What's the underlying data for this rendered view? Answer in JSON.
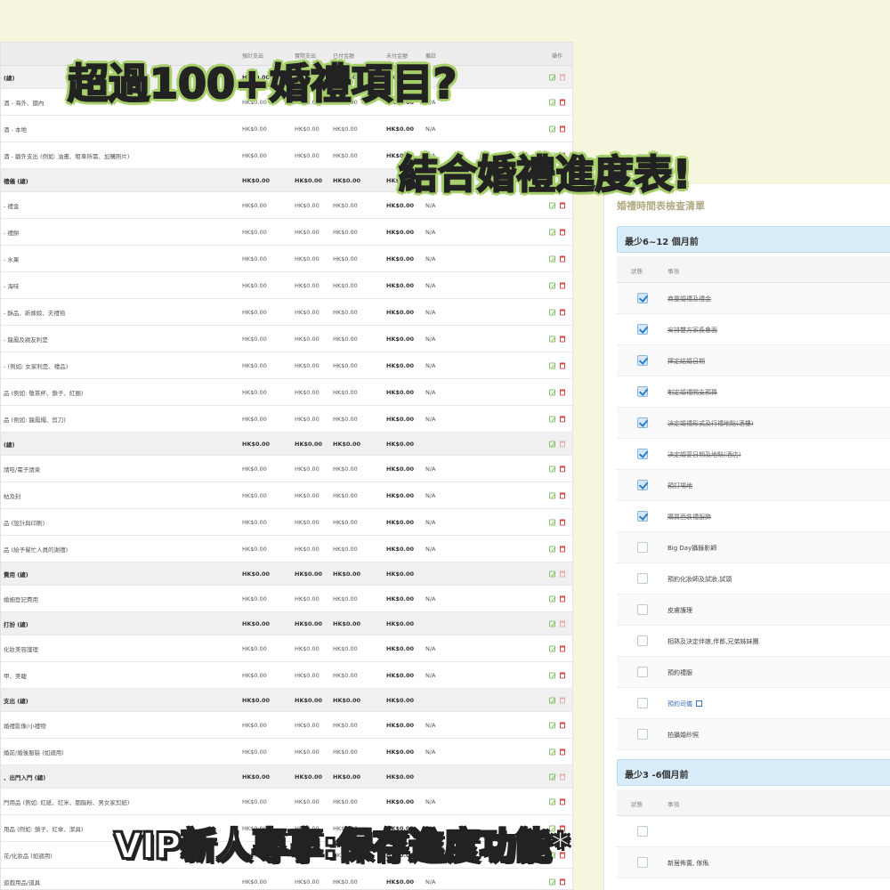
{
  "budget_table": {
    "headers": {
      "estimated": "預計支出",
      "actual": "實際支出",
      "paid": "已付金額",
      "unpaid": "未付金額",
      "note": "備註",
      "operation": "操作"
    },
    "rows": [
      {
        "type": "category",
        "name": "(總)",
        "est": "HK$0.00",
        "act": "HK$0.00",
        "paid": "HK$0.00",
        "unpaid": "HK$0.00",
        "note": ""
      },
      {
        "type": "item",
        "name": "酒 - 海外、國內",
        "est": "HK$0.00",
        "act": "HK$0.00",
        "paid": "HK$0.00",
        "unpaid": "HK$0.00",
        "note": "N/A"
      },
      {
        "type": "item",
        "name": "酒 - 本地",
        "est": "HK$0.00",
        "act": "HK$0.00",
        "paid": "HK$0.00",
        "unpaid": "HK$0.00",
        "note": "N/A"
      },
      {
        "type": "item",
        "name": "酒 - 額外支出 (例如: 油畫、租車所需、加購照片)",
        "est": "HK$0.00",
        "act": "HK$0.00",
        "paid": "HK$0.00",
        "unpaid": "HK$0.00",
        "note": "N/A"
      },
      {
        "type": "category",
        "name": "禮儀 (總)",
        "est": "HK$0.00",
        "act": "HK$0.00",
        "paid": "HK$0.00",
        "unpaid": "HK$0.00",
        "note": ""
      },
      {
        "type": "item",
        "name": "- 禮金",
        "est": "HK$0.00",
        "act": "HK$0.00",
        "paid": "HK$0.00",
        "unpaid": "HK$0.00",
        "note": "N/A"
      },
      {
        "type": "item",
        "name": "- 禮餅",
        "est": "HK$0.00",
        "act": "HK$0.00",
        "paid": "HK$0.00",
        "unpaid": "HK$0.00",
        "note": "N/A"
      },
      {
        "type": "item",
        "name": "- 水果",
        "est": "HK$0.00",
        "act": "HK$0.00",
        "paid": "HK$0.00",
        "unpaid": "HK$0.00",
        "note": "N/A"
      },
      {
        "type": "item",
        "name": "- 海味",
        "est": "HK$0.00",
        "act": "HK$0.00",
        "paid": "HK$0.00",
        "unpaid": "HK$0.00",
        "note": "N/A"
      },
      {
        "type": "item",
        "name": "- 酥品、新嫁娘、夫禮袍",
        "est": "HK$0.00",
        "act": "HK$0.00",
        "paid": "HK$0.00",
        "unpaid": "HK$0.00",
        "note": "N/A"
      },
      {
        "type": "item",
        "name": "- 龍鳳及親友利是",
        "est": "HK$0.00",
        "act": "HK$0.00",
        "paid": "HK$0.00",
        "unpaid": "HK$0.00",
        "note": "N/A"
      },
      {
        "type": "item",
        "name": "- (例如: 女家利是、禮品)",
        "est": "HK$0.00",
        "act": "HK$0.00",
        "paid": "HK$0.00",
        "unpaid": "HK$0.00",
        "note": "N/A"
      },
      {
        "type": "item",
        "name": "品 (例如: 敬茶杯、鎖子、紅圈)",
        "est": "HK$0.00",
        "act": "HK$0.00",
        "paid": "HK$0.00",
        "unpaid": "HK$0.00",
        "note": "N/A"
      },
      {
        "type": "item",
        "name": "品 (例如: 龍鳳燭、剪刀)",
        "est": "HK$0.00",
        "act": "HK$0.00",
        "paid": "HK$0.00",
        "unpaid": "HK$0.00",
        "note": "N/A"
      },
      {
        "type": "category",
        "name": "(總)",
        "est": "HK$0.00",
        "act": "HK$0.00",
        "paid": "HK$0.00",
        "unpaid": "HK$0.00",
        "note": ""
      },
      {
        "type": "item",
        "name": "請咭/電子請柬",
        "est": "HK$0.00",
        "act": "HK$0.00",
        "paid": "HK$0.00",
        "unpaid": "HK$0.00",
        "note": "N/A"
      },
      {
        "type": "item",
        "name": "帖及封",
        "est": "HK$0.00",
        "act": "HK$0.00",
        "paid": "HK$0.00",
        "unpaid": "HK$0.00",
        "note": "N/A"
      },
      {
        "type": "item",
        "name": "品 (設計與印刷)",
        "est": "HK$0.00",
        "act": "HK$0.00",
        "paid": "HK$0.00",
        "unpaid": "HK$0.00",
        "note": "N/A"
      },
      {
        "type": "item",
        "name": "品 (給予幫忙人員的謝禮)",
        "est": "HK$0.00",
        "act": "HK$0.00",
        "paid": "HK$0.00",
        "unpaid": "HK$0.00",
        "note": "N/A"
      },
      {
        "type": "category",
        "name": "費用 (總)",
        "est": "HK$0.00",
        "act": "HK$0.00",
        "paid": "HK$0.00",
        "unpaid": "HK$0.00",
        "note": ""
      },
      {
        "type": "item",
        "name": "婚姻登記費用",
        "est": "HK$0.00",
        "act": "HK$0.00",
        "paid": "HK$0.00",
        "unpaid": "HK$0.00",
        "note": "N/A"
      },
      {
        "type": "category",
        "name": "打扮 (總)",
        "est": "HK$0.00",
        "act": "HK$0.00",
        "paid": "HK$0.00",
        "unpaid": "HK$0.00",
        "note": ""
      },
      {
        "type": "item",
        "name": "化妝美容護理",
        "est": "HK$0.00",
        "act": "HK$0.00",
        "paid": "HK$0.00",
        "unpaid": "HK$0.00",
        "note": "N/A"
      },
      {
        "type": "item",
        "name": "甲、美睫",
        "est": "HK$0.00",
        "act": "HK$0.00",
        "paid": "HK$0.00",
        "unpaid": "HK$0.00",
        "note": "N/A"
      },
      {
        "type": "category",
        "name": "支出 (總)",
        "est": "HK$0.00",
        "act": "HK$0.00",
        "paid": "HK$0.00",
        "unpaid": "HK$0.00",
        "note": ""
      },
      {
        "type": "item",
        "name": "婚禮影像/小禮物",
        "est": "HK$0.00",
        "act": "HK$0.00",
        "paid": "HK$0.00",
        "unpaid": "HK$0.00",
        "note": "N/A"
      },
      {
        "type": "item",
        "name": "婚前/婚後服裝 (如適用)",
        "est": "HK$0.00",
        "act": "HK$0.00",
        "paid": "HK$0.00",
        "unpaid": "HK$0.00",
        "note": "N/A"
      },
      {
        "type": "category",
        "name": "、出門入門 (總)",
        "est": "HK$0.00",
        "act": "HK$0.00",
        "paid": "HK$0.00",
        "unpaid": "HK$0.00",
        "note": ""
      },
      {
        "type": "item",
        "name": "門用品 (例如: 紅紙、紅米、胭脂粉、男女家剪紙)",
        "est": "HK$0.00",
        "act": "HK$0.00",
        "paid": "HK$0.00",
        "unpaid": "HK$0.00",
        "note": "N/A"
      },
      {
        "type": "item",
        "name": "用品 (例如: 鎖子、紅傘、潔具)",
        "est": "HK$0.00",
        "act": "HK$0.00",
        "paid": "HK$0.00",
        "unpaid": "HK$0.00",
        "note": "N/A"
      },
      {
        "type": "item",
        "name": "花/化妝品 (如適用)",
        "est": "HK$0.00",
        "act": "HK$0.00",
        "paid": "HK$0.00",
        "unpaid": "HK$0.00",
        "note": "N/A"
      },
      {
        "type": "item",
        "name": "遊戲用品/道具",
        "est": "HK$0.00",
        "act": "HK$0.00",
        "paid": "HK$0.00",
        "unpaid": "HK$0.00",
        "note": "N/A"
      }
    ]
  },
  "checklist": {
    "title": "婚禮時間表檢查清單",
    "col_status": "狀態",
    "col_item": "事項",
    "phases": [
      {
        "label": "最少6~12 個月前",
        "items": [
          {
            "text": "商量婚禮及禮金",
            "checked": true
          },
          {
            "text": "安排雙方家長會面",
            "checked": true
          },
          {
            "text": "擇定結婚日期",
            "checked": true
          },
          {
            "text": "制定婚禮開支預算",
            "checked": true
          },
          {
            "text": "決定婚禮形式及行禮地點(酒樓)",
            "checked": true
          },
          {
            "text": "決定婚宴日期及地點(酒店)",
            "checked": true
          },
          {
            "text": "預訂場地",
            "checked": true
          },
          {
            "text": "購買西裝禮服飾",
            "checked": true
          },
          {
            "text": "Big Day攝錄影師",
            "checked": false
          },
          {
            "text": "預約化妝師及試妝,試頭",
            "checked": false
          },
          {
            "text": "皮膚護理",
            "checked": false
          },
          {
            "text": "相熟及決定伴娘,伴郎,兄弟姊妹團",
            "checked": false
          },
          {
            "text": "預約禮服",
            "checked": false
          },
          {
            "text": "預約司儀",
            "checked": false,
            "link": true
          },
          {
            "text": "拍攝婚紗照",
            "checked": false
          }
        ]
      },
      {
        "label": "最少3 -6個月前",
        "items": [
          {
            "text": "",
            "checked": false
          },
          {
            "text": "新居佈置, 傢俬",
            "checked": false
          }
        ]
      }
    ]
  },
  "overlay": {
    "headline_1": "超過100+婚禮項目?",
    "headline_2": "結合婚禮進度表!",
    "vip_banner": "VIP新人專享:保存進度功能*"
  }
}
